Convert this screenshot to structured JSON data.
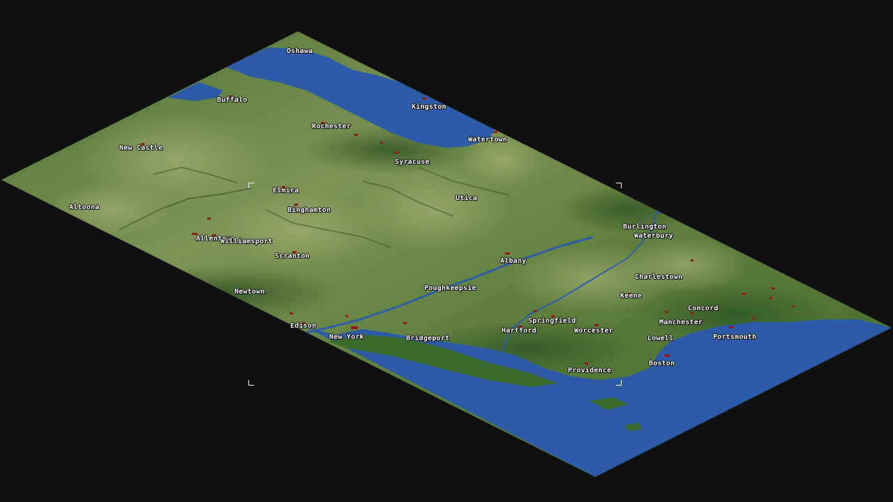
{
  "map": {
    "colors": {
      "background": "#111111",
      "water": "#2d5ba8",
      "land_dark": "#2f5526",
      "land_light": "#8a9d5c",
      "river": "#2d5ba8",
      "town": "#8b1a1a"
    },
    "cities": [
      {
        "name": "Oshawa"
      },
      {
        "name": "Buffalo"
      },
      {
        "name": "Kingston"
      },
      {
        "name": "Rochester"
      },
      {
        "name": "Watertown"
      },
      {
        "name": "New Castle"
      },
      {
        "name": "Syracuse"
      },
      {
        "name": "Elmira"
      },
      {
        "name": "Utica"
      },
      {
        "name": "Altoona"
      },
      {
        "name": "Binghamton"
      },
      {
        "name": "Burlington"
      },
      {
        "name": "Waterbury"
      },
      {
        "name": "Allentown"
      },
      {
        "name": "Williamsport"
      },
      {
        "name": "Scranton"
      },
      {
        "name": "Albany"
      },
      {
        "name": "Charlestown"
      },
      {
        "name": "Newtown"
      },
      {
        "name": "Poughkeepsie"
      },
      {
        "name": "Keene"
      },
      {
        "name": "Concord"
      },
      {
        "name": "Springfield"
      },
      {
        "name": "Manchester"
      },
      {
        "name": "Edison"
      },
      {
        "name": "Hartford"
      },
      {
        "name": "Worcester"
      },
      {
        "name": "Portsmouth"
      },
      {
        "name": "New York"
      },
      {
        "name": "Bridgeport"
      },
      {
        "name": "Lowell"
      },
      {
        "name": "Boston"
      },
      {
        "name": "Providence"
      }
    ]
  }
}
